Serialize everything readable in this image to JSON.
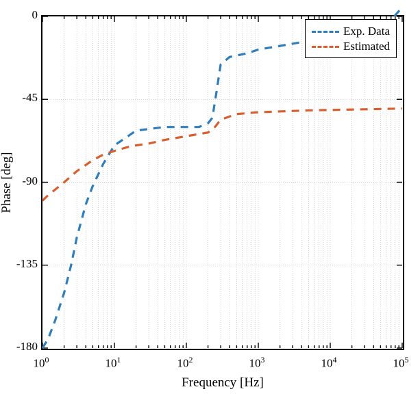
{
  "chart_data": {
    "type": "line",
    "title": "",
    "xlabel": "Frequency [Hz]",
    "ylabel": "Phase [deg]",
    "xscale": "log",
    "xlim": [
      1,
      100000
    ],
    "ylim": [
      -180,
      0
    ],
    "xticks": [
      {
        "value": 1,
        "label": "10^0"
      },
      {
        "value": 10,
        "label": "10^1"
      },
      {
        "value": 100,
        "label": "10^2"
      },
      {
        "value": 1000,
        "label": "10^3"
      },
      {
        "value": 10000,
        "label": "10^4"
      },
      {
        "value": 100000,
        "label": "10^5"
      }
    ],
    "yticks": [
      {
        "value": -180,
        "label": "-180"
      },
      {
        "value": -135,
        "label": "-135"
      },
      {
        "value": -90,
        "label": "-90"
      },
      {
        "value": -45,
        "label": "-45"
      },
      {
        "value": 0,
        "label": "0"
      }
    ],
    "legend": {
      "position": "upper-right",
      "entries": [
        {
          "name": "Exp. Data",
          "color": "#2e7ebd"
        },
        {
          "name": "Estimated",
          "color": "#d85f2d"
        }
      ]
    },
    "series": [
      {
        "name": "Exp. Data",
        "color": "#2e7ebd",
        "x": [
          1,
          1.2,
          1.5,
          2,
          2.5,
          3,
          4,
          5,
          7,
          10,
          20,
          50,
          100,
          150,
          200,
          230,
          260,
          300,
          400,
          700,
          1000,
          2000,
          4000,
          10000,
          30000,
          60000,
          100000
        ],
        "y": [
          -180,
          -175,
          -165,
          -150,
          -135,
          -120,
          -102,
          -92,
          -80,
          -70,
          -62,
          -60,
          -60,
          -60,
          -58,
          -55,
          -42,
          -26,
          -22,
          -20,
          -18,
          -16,
          -14,
          -12,
          -10,
          -5,
          5
        ]
      },
      {
        "name": "Estimated",
        "color": "#d85f2d",
        "x": [
          1,
          1.2,
          1.5,
          2,
          3,
          5,
          7,
          10,
          15,
          20,
          30,
          50,
          100,
          200,
          250,
          300,
          500,
          1000,
          5000,
          100000
        ],
        "y": [
          -100,
          -97,
          -94,
          -90,
          -84,
          -78,
          -75,
          -73,
          -71,
          -70,
          -69,
          -67,
          -65,
          -63,
          -60,
          -56,
          -53,
          -52,
          -51,
          -50
        ]
      }
    ]
  }
}
